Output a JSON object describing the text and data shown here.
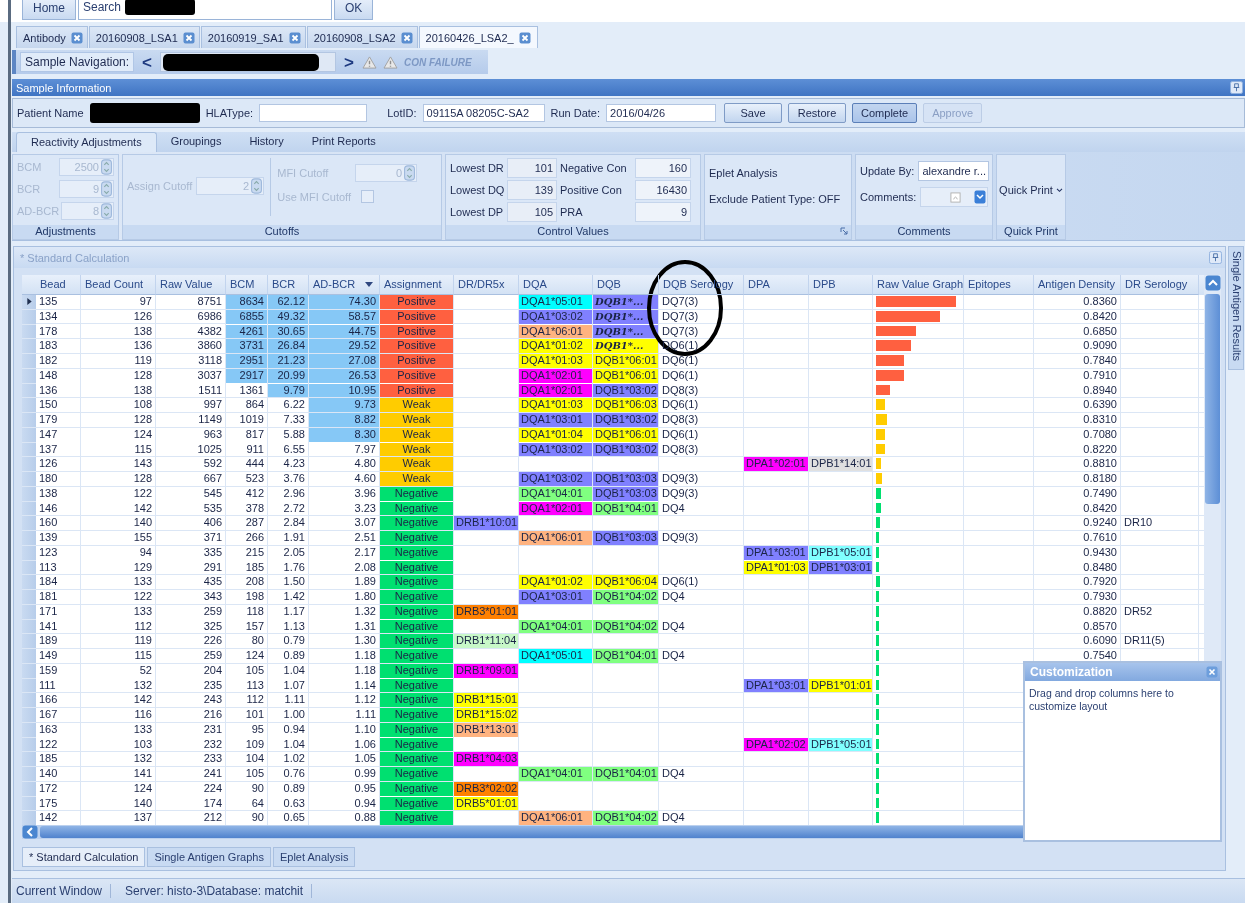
{
  "top_bar": {
    "home": "Home",
    "search_label": "Search",
    "ok": "OK"
  },
  "document_tabs": [
    {
      "label": "Antibody",
      "selected": false
    },
    {
      "label": "20160908_LSA1",
      "selected": false
    },
    {
      "label": "20160919_SA1",
      "selected": false
    },
    {
      "label": "20160908_LSA2",
      "selected": false
    },
    {
      "label": "20160426_LSA2_",
      "selected": true
    }
  ],
  "sample_navigation": {
    "label": "Sample Navigation:",
    "prev": "<",
    "next": ">",
    "status": "CON FAILURE"
  },
  "sample_information": {
    "title": "Sample Information",
    "patient_name_label": "Patient Name",
    "hla_type_label": "HLAType:",
    "lot_id_label": "LotID:",
    "lot_id": "09115A 08205C-SA2",
    "run_date_label": "Run Date:",
    "run_date": "2016/04/26",
    "buttons": [
      {
        "label": "Save",
        "disabled": false,
        "pressed": false
      },
      {
        "label": "Restore",
        "disabled": false,
        "pressed": false
      },
      {
        "label": "Complete",
        "disabled": false,
        "pressed": true
      },
      {
        "label": "Approve",
        "disabled": true,
        "pressed": false
      }
    ]
  },
  "ribbon_tabs": [
    {
      "label": "Reactivity Adjustments",
      "selected": true
    },
    {
      "label": "Groupings",
      "selected": false
    },
    {
      "label": "History",
      "selected": false
    },
    {
      "label": "Print Reports",
      "selected": false
    }
  ],
  "ribbon": {
    "adjustments": {
      "title": "Adjustments",
      "disabled": true,
      "fields": [
        {
          "label": "BCM",
          "value": "2500"
        },
        {
          "label": "BCR",
          "value": "9"
        },
        {
          "label": "AD-BCR",
          "value": "8"
        }
      ]
    },
    "cutoffs": {
      "title": "Cutoffs",
      "disabled": true,
      "assign_cutoff": {
        "label": "Assign Cutoff",
        "value": "2"
      },
      "mfi_cutoff": {
        "label": "MFI Cutoff",
        "value": "0"
      },
      "use_mfi_cutoff": {
        "label": "Use MFI Cutoff",
        "checked": false
      }
    },
    "control_values": {
      "title": "Control Values",
      "fields": [
        {
          "label": "Lowest DR",
          "value": "101"
        },
        {
          "label": "Negative Con",
          "value": "160"
        },
        {
          "label": "Lowest DQ",
          "value": "139"
        },
        {
          "label": "Positive Con",
          "value": "16430"
        },
        {
          "label": "Lowest DP",
          "value": "105"
        },
        {
          "label": "PRA",
          "value": "9"
        }
      ]
    },
    "eplet": {
      "items": [
        "Eplet Analysis",
        "Exclude Patient Type: OFF"
      ]
    },
    "comments": {
      "title": "Comments",
      "update_by_label": "Update By:",
      "update_by": "alexandre r...",
      "comments_label": "Comments:"
    },
    "quick_print": {
      "title": "Quick Print",
      "button": "Quick Print"
    }
  },
  "grid": {
    "title": "* Standard Calculation",
    "columns": [
      {
        "label": "Bead",
        "sorted": false
      },
      {
        "label": "Bead Count",
        "sorted": false
      },
      {
        "label": "Raw Value",
        "sorted": false
      },
      {
        "label": "BCM",
        "sorted": false
      },
      {
        "label": "BCR",
        "sorted": false
      },
      {
        "label": "AD-BCR",
        "sorted": true
      },
      {
        "label": "Assignment",
        "sorted": false
      },
      {
        "label": "DR/DR5x",
        "sorted": false
      },
      {
        "label": "DQA",
        "sorted": false
      },
      {
        "label": "DQB",
        "sorted": false
      },
      {
        "label": "DQB Serology",
        "sorted": false
      },
      {
        "label": "DPA",
        "sorted": false
      },
      {
        "label": "DPB",
        "sorted": false
      },
      {
        "label": "Raw Value Graph",
        "sorted": false
      },
      {
        "label": "Epitopes",
        "sorted": false
      },
      {
        "label": "Antigen Density",
        "sorted": false
      },
      {
        "label": "DR Serology",
        "sorted": false
      }
    ],
    "rows": [
      {
        "current": true,
        "bead": "135",
        "bead_count": "97",
        "raw_value": "8751",
        "bcm": "8634",
        "bcr": "62.12",
        "ad_bcr": "74.30",
        "bcm_flagged": true,
        "bcr_flagged": true,
        "ad_bcr_flagged": true,
        "assignment": {
          "text": "Positive",
          "color": "#ff6040"
        },
        "dqa": {
          "text": "DQA1*05:01",
          "color": "#00ffff"
        },
        "dqb": {
          "text": "DQB1*...",
          "color": "#8080ff",
          "bold": true
        },
        "dqb_serology": "DQ7(3)",
        "graph": {
          "color": "#ff6040"
        },
        "antigen_density": "0.8360"
      },
      {
        "current": false,
        "bead": "134",
        "bead_count": "126",
        "raw_value": "6986",
        "bcm": "6855",
        "bcr": "49.32",
        "ad_bcr": "58.57",
        "bcm_flagged": true,
        "bcr_flagged": true,
        "ad_bcr_flagged": true,
        "assignment": {
          "text": "Positive",
          "color": "#ff6040"
        },
        "dqa": {
          "text": "DQA1*03:02",
          "color": "#8080ff"
        },
        "dqb": {
          "text": "DQB1*...",
          "color": "#8080ff",
          "bold": true
        },
        "dqb_serology": "DQ7(3)",
        "graph": {
          "color": "#ff6040"
        },
        "antigen_density": "0.8420"
      },
      {
        "current": false,
        "bead": "178",
        "bead_count": "138",
        "raw_value": "4382",
        "bcm": "4261",
        "bcr": "30.65",
        "ad_bcr": "44.75",
        "bcm_flagged": true,
        "bcr_flagged": true,
        "ad_bcr_flagged": true,
        "assignment": {
          "text": "Positive",
          "color": "#ff6040"
        },
        "dqa": {
          "text": "DQA1*06:01",
          "color": "#ffb380"
        },
        "dqb": {
          "text": "DQB1*...",
          "color": "#8080ff",
          "bold": true
        },
        "dqb_serology": "DQ7(3)",
        "graph": {
          "color": "#ff6040"
        },
        "antigen_density": "0.6850"
      },
      {
        "current": false,
        "bead": "183",
        "bead_count": "136",
        "raw_value": "3860",
        "bcm": "3731",
        "bcr": "26.84",
        "ad_bcr": "29.52",
        "bcm_flagged": true,
        "bcr_flagged": true,
        "ad_bcr_flagged": true,
        "assignment": {
          "text": "Positive",
          "color": "#ff6040"
        },
        "dqa": {
          "text": "DQA1*01:02",
          "color": "#ffff00"
        },
        "dqb": {
          "text": "DQB1*...",
          "color": "#ffff00",
          "bold": true
        },
        "dqb_serology": "DQ6(1)",
        "graph": {
          "color": "#ff6040"
        },
        "antigen_density": "0.9090"
      },
      {
        "current": false,
        "bead": "182",
        "bead_count": "119",
        "raw_value": "3118",
        "bcm": "2951",
        "bcr": "21.23",
        "ad_bcr": "27.08",
        "bcm_flagged": true,
        "bcr_flagged": true,
        "ad_bcr_flagged": true,
        "assignment": {
          "text": "Positive",
          "color": "#ff6040"
        },
        "dqa": {
          "text": "DQA1*01:03",
          "color": "#ffff00"
        },
        "dqb": {
          "text": "DQB1*06:01",
          "color": "#ffff00"
        },
        "dqb_serology": "DQ6(1)",
        "graph": {
          "color": "#ff6040"
        },
        "antigen_density": "0.7840"
      },
      {
        "current": false,
        "bead": "148",
        "bead_count": "128",
        "raw_value": "3037",
        "bcm": "2917",
        "bcr": "20.99",
        "ad_bcr": "26.53",
        "bcm_flagged": true,
        "bcr_flagged": true,
        "ad_bcr_flagged": true,
        "assignment": {
          "text": "Positive",
          "color": "#ff6040"
        },
        "dqa": {
          "text": "DQA1*02:01",
          "color": "#ff00ff"
        },
        "dqb": {
          "text": "DQB1*06:01",
          "color": "#ffff00"
        },
        "dqb_serology": "DQ6(1)",
        "graph": {
          "color": "#ff6040"
        },
        "antigen_density": "0.7910"
      },
      {
        "current": false,
        "bead": "136",
        "bead_count": "138",
        "raw_value": "1511",
        "bcm": "1361",
        "bcr": "9.79",
        "ad_bcr": "10.95",
        "bcm_flagged": false,
        "bcr_flagged": true,
        "ad_bcr_flagged": true,
        "assignment": {
          "text": "Positive",
          "color": "#ff6040"
        },
        "dqa": {
          "text": "DQA1*02:01",
          "color": "#ff00ff"
        },
        "dqb": {
          "text": "DQB1*03:02",
          "color": "#8080ff"
        },
        "dqb_serology": "DQ8(3)",
        "graph": {
          "color": "#ff6040"
        },
        "antigen_density": "0.8940"
      },
      {
        "current": false,
        "bead": "150",
        "bead_count": "108",
        "raw_value": "997",
        "bcm": "864",
        "bcr": "6.22",
        "ad_bcr": "9.73",
        "bcm_flagged": false,
        "bcr_flagged": false,
        "ad_bcr_flagged": true,
        "assignment": {
          "text": "Weak",
          "color": "#ffcc00"
        },
        "dqa": {
          "text": "DQA1*01:03",
          "color": "#ffff00"
        },
        "dqb": {
          "text": "DQB1*06:03",
          "color": "#ffff00"
        },
        "dqb_serology": "DQ6(1)",
        "graph": {
          "color": "#ffcc00"
        },
        "antigen_density": "0.6390"
      },
      {
        "current": false,
        "bead": "179",
        "bead_count": "128",
        "raw_value": "1149",
        "bcm": "1019",
        "bcr": "7.33",
        "ad_bcr": "8.82",
        "bcm_flagged": false,
        "bcr_flagged": false,
        "ad_bcr_flagged": true,
        "assignment": {
          "text": "Weak",
          "color": "#ffcc00"
        },
        "dqa": {
          "text": "DQA1*03:01",
          "color": "#8080ff"
        },
        "dqb": {
          "text": "DQB1*03:02",
          "color": "#8080ff"
        },
        "dqb_serology": "DQ8(3)",
        "graph": {
          "color": "#ffcc00"
        },
        "antigen_density": "0.8310"
      },
      {
        "current": false,
        "bead": "147",
        "bead_count": "124",
        "raw_value": "963",
        "bcm": "817",
        "bcr": "5.88",
        "ad_bcr": "8.30",
        "bcm_flagged": false,
        "bcr_flagged": false,
        "ad_bcr_flagged": true,
        "assignment": {
          "text": "Weak",
          "color": "#ffcc00"
        },
        "dqa": {
          "text": "DQA1*01:04",
          "color": "#ffff00"
        },
        "dqb": {
          "text": "DQB1*06:01",
          "color": "#ffff00"
        },
        "dqb_serology": "DQ6(1)",
        "graph": {
          "color": "#ffcc00"
        },
        "antigen_density": "0.7080"
      },
      {
        "current": false,
        "bead": "137",
        "bead_count": "115",
        "raw_value": "1025",
        "bcm": "911",
        "bcr": "6.55",
        "ad_bcr": "7.97",
        "bcm_flagged": false,
        "bcr_flagged": false,
        "ad_bcr_flagged": false,
        "assignment": {
          "text": "Weak",
          "color": "#ffcc00"
        },
        "dqa": {
          "text": "DQA1*03:02",
          "color": "#8080ff"
        },
        "dqb": {
          "text": "DQB1*03:02",
          "color": "#8080ff"
        },
        "dqb_serology": "DQ8(3)",
        "graph": {
          "color": "#ffcc00"
        },
        "antigen_density": "0.8220"
      },
      {
        "current": false,
        "bead": "126",
        "bead_count": "143",
        "raw_value": "592",
        "bcm": "444",
        "bcr": "4.23",
        "ad_bcr": "4.80",
        "bcm_flagged": false,
        "bcr_flagged": false,
        "ad_bcr_flagged": false,
        "assignment": {
          "text": "Weak",
          "color": "#ffcc00"
        },
        "dpa": {
          "text": "DPA1*02:01",
          "color": "#ff00ff"
        },
        "dpb": {
          "text": "DPB1*14:01",
          "color": "#e0e0e0"
        },
        "graph": {
          "color": "#ffcc00"
        },
        "antigen_density": "0.8810"
      },
      {
        "current": false,
        "bead": "180",
        "bead_count": "128",
        "raw_value": "667",
        "bcm": "523",
        "bcr": "3.76",
        "ad_bcr": "4.60",
        "bcm_flagged": false,
        "bcr_flagged": false,
        "ad_bcr_flagged": false,
        "assignment": {
          "text": "Weak",
          "color": "#ffcc00"
        },
        "dqa": {
          "text": "DQA1*03:02",
          "color": "#8080ff"
        },
        "dqb": {
          "text": "DQB1*03:03",
          "color": "#8080ff"
        },
        "dqb_serology": "DQ9(3)",
        "graph": {
          "color": "#ffcc00"
        },
        "antigen_density": "0.8180"
      },
      {
        "current": false,
        "bead": "138",
        "bead_count": "122",
        "raw_value": "545",
        "bcm": "412",
        "bcr": "2.96",
        "ad_bcr": "3.96",
        "bcm_flagged": false,
        "bcr_flagged": false,
        "ad_bcr_flagged": false,
        "assignment": {
          "text": "Negative",
          "color": "#00e070"
        },
        "dqa": {
          "text": "DQA1*04:01",
          "color": "#80ff80"
        },
        "dqb": {
          "text": "DQB1*03:03",
          "color": "#8080ff"
        },
        "dqb_serology": "DQ9(3)",
        "graph": {
          "color": "#00e070"
        },
        "antigen_density": "0.7490"
      },
      {
        "current": false,
        "bead": "146",
        "bead_count": "142",
        "raw_value": "535",
        "bcm": "378",
        "bcr": "2.72",
        "ad_bcr": "3.23",
        "bcm_flagged": false,
        "bcr_flagged": false,
        "ad_bcr_flagged": false,
        "assignment": {
          "text": "Negative",
          "color": "#00e070"
        },
        "dqa": {
          "text": "DQA1*02:01",
          "color": "#ff00ff"
        },
        "dqb": {
          "text": "DQB1*04:01",
          "color": "#80ff80"
        },
        "dqb_serology": "DQ4",
        "graph": {
          "color": "#00e070"
        },
        "antigen_density": "0.8420"
      },
      {
        "current": false,
        "bead": "160",
        "bead_count": "140",
        "raw_value": "406",
        "bcm": "287",
        "bcr": "2.84",
        "ad_bcr": "3.07",
        "bcm_flagged": false,
        "bcr_flagged": false,
        "ad_bcr_flagged": false,
        "assignment": {
          "text": "Negative",
          "color": "#00e070"
        },
        "dr_dr5x": {
          "text": "DRB1*10:01",
          "color": "#8080ff"
        },
        "graph": {
          "color": "#00e070"
        },
        "antigen_density": "0.9240",
        "dr_serology": "DR10"
      },
      {
        "current": false,
        "bead": "139",
        "bead_count": "155",
        "raw_value": "371",
        "bcm": "266",
        "bcr": "1.91",
        "ad_bcr": "2.51",
        "bcm_flagged": false,
        "bcr_flagged": false,
        "ad_bcr_flagged": false,
        "assignment": {
          "text": "Negative",
          "color": "#00e070"
        },
        "dqa": {
          "text": "DQA1*06:01",
          "color": "#ffb380"
        },
        "dqb": {
          "text": "DQB1*03:03",
          "color": "#8080ff"
        },
        "dqb_serology": "DQ9(3)",
        "graph": {
          "color": "#00e070"
        },
        "antigen_density": "0.7610"
      },
      {
        "current": false,
        "bead": "123",
        "bead_count": "94",
        "raw_value": "335",
        "bcm": "215",
        "bcr": "2.05",
        "ad_bcr": "2.17",
        "bcm_flagged": false,
        "bcr_flagged": false,
        "ad_bcr_flagged": false,
        "assignment": {
          "text": "Negative",
          "color": "#00e070"
        },
        "dpa": {
          "text": "DPA1*03:01",
          "color": "#8080ff"
        },
        "dpb": {
          "text": "DPB1*05:01",
          "color": "#80ffff"
        },
        "graph": {
          "color": "#00e070"
        },
        "antigen_density": "0.9430"
      },
      {
        "current": false,
        "bead": "113",
        "bead_count": "129",
        "raw_value": "291",
        "bcm": "185",
        "bcr": "1.76",
        "ad_bcr": "2.08",
        "bcm_flagged": false,
        "bcr_flagged": false,
        "ad_bcr_flagged": false,
        "assignment": {
          "text": "Negative",
          "color": "#00e070"
        },
        "dpa": {
          "text": "DPA1*01:03",
          "color": "#ffff00"
        },
        "dpb": {
          "text": "DPB1*03:01",
          "color": "#8080ff"
        },
        "graph": {
          "color": "#00e070"
        },
        "antigen_density": "0.8480"
      },
      {
        "current": false,
        "bead": "184",
        "bead_count": "133",
        "raw_value": "435",
        "bcm": "208",
        "bcr": "1.50",
        "ad_bcr": "1.89",
        "bcm_flagged": false,
        "bcr_flagged": false,
        "ad_bcr_flagged": false,
        "assignment": {
          "text": "Negative",
          "color": "#00e070"
        },
        "dqa": {
          "text": "DQA1*01:02",
          "color": "#ffff00"
        },
        "dqb": {
          "text": "DQB1*06:04",
          "color": "#ffff00"
        },
        "dqb_serology": "DQ6(1)",
        "graph": {
          "color": "#00e070"
        },
        "antigen_density": "0.7920"
      },
      {
        "current": false,
        "bead": "181",
        "bead_count": "122",
        "raw_value": "343",
        "bcm": "198",
        "bcr": "1.42",
        "ad_bcr": "1.80",
        "bcm_flagged": false,
        "bcr_flagged": false,
        "ad_bcr_flagged": false,
        "assignment": {
          "text": "Negative",
          "color": "#00e070"
        },
        "dqa": {
          "text": "DQA1*03:01",
          "color": "#8080ff"
        },
        "dqb": {
          "text": "DQB1*04:02",
          "color": "#80ff80"
        },
        "dqb_serology": "DQ4",
        "graph": {
          "color": "#00e070"
        },
        "antigen_density": "0.7930"
      },
      {
        "current": false,
        "bead": "171",
        "bead_count": "133",
        "raw_value": "259",
        "bcm": "118",
        "bcr": "1.17",
        "ad_bcr": "1.32",
        "bcm_flagged": false,
        "bcr_flagged": false,
        "ad_bcr_flagged": false,
        "assignment": {
          "text": "Negative",
          "color": "#00e070"
        },
        "dr_dr5x": {
          "text": "DRB3*01:01",
          "color": "#ff8000"
        },
        "graph": {
          "color": "#00e070"
        },
        "antigen_density": "0.8820",
        "dr_serology": "DR52"
      },
      {
        "current": false,
        "bead": "141",
        "bead_count": "112",
        "raw_value": "325",
        "bcm": "157",
        "bcr": "1.13",
        "ad_bcr": "1.31",
        "bcm_flagged": false,
        "bcr_flagged": false,
        "ad_bcr_flagged": false,
        "assignment": {
          "text": "Negative",
          "color": "#00e070"
        },
        "dqa": {
          "text": "DQA1*04:01",
          "color": "#80ff80"
        },
        "dqb": {
          "text": "DQB1*04:02",
          "color": "#80ff80"
        },
        "dqb_serology": "DQ4",
        "graph": {
          "color": "#00e070"
        },
        "antigen_density": "0.8570"
      },
      {
        "current": false,
        "bead": "189",
        "bead_count": "119",
        "raw_value": "226",
        "bcm": "80",
        "bcr": "0.79",
        "ad_bcr": "1.30",
        "bcm_flagged": false,
        "bcr_flagged": false,
        "ad_bcr_flagged": false,
        "assignment": {
          "text": "Negative",
          "color": "#00e070"
        },
        "dr_dr5x": {
          "text": "DRB1*11:04",
          "color": "#c8f8c8"
        },
        "graph": {
          "color": "#00e070"
        },
        "antigen_density": "0.6090",
        "dr_serology": "DR11(5)"
      },
      {
        "current": false,
        "bead": "149",
        "bead_count": "115",
        "raw_value": "259",
        "bcm": "124",
        "bcr": "0.89",
        "ad_bcr": "1.18",
        "bcm_flagged": false,
        "bcr_flagged": false,
        "ad_bcr_flagged": false,
        "assignment": {
          "text": "Negative",
          "color": "#00e070"
        },
        "dqa": {
          "text": "DQA1*05:01",
          "color": "#00ffff"
        },
        "dqb": {
          "text": "DQB1*04:01",
          "color": "#80ff80"
        },
        "dqb_serology": "DQ4",
        "graph": {
          "color": "#00e070"
        },
        "antigen_density": "0.7540"
      },
      {
        "current": false,
        "bead": "159",
        "bead_count": "52",
        "raw_value": "204",
        "bcm": "105",
        "bcr": "1.04",
        "ad_bcr": "1.18",
        "bcm_flagged": false,
        "bcr_flagged": false,
        "ad_bcr_flagged": false,
        "assignment": {
          "text": "Negative",
          "color": "#00e070"
        },
        "dr_dr5x": {
          "text": "DRB1*09:01",
          "color": "#ff00ff"
        },
        "graph": {
          "color": "#00e070"
        }
      },
      {
        "current": false,
        "bead": "111",
        "bead_count": "132",
        "raw_value": "235",
        "bcm": "113",
        "bcr": "1.07",
        "ad_bcr": "1.14",
        "bcm_flagged": false,
        "bcr_flagged": false,
        "ad_bcr_flagged": false,
        "assignment": {
          "text": "Negative",
          "color": "#00e070"
        },
        "dpa": {
          "text": "DPA1*03:01",
          "color": "#8080ff"
        },
        "dpb": {
          "text": "DPB1*01:01",
          "color": "#ffff00"
        },
        "graph": {
          "color": "#00e070"
        }
      },
      {
        "current": false,
        "bead": "166",
        "bead_count": "142",
        "raw_value": "243",
        "bcm": "112",
        "bcr": "1.11",
        "ad_bcr": "1.12",
        "bcm_flagged": false,
        "bcr_flagged": false,
        "ad_bcr_flagged": false,
        "assignment": {
          "text": "Negative",
          "color": "#00e070"
        },
        "dr_dr5x": {
          "text": "DRB1*15:01",
          "color": "#ffff00"
        },
        "graph": {
          "color": "#00e070"
        }
      },
      {
        "current": false,
        "bead": "167",
        "bead_count": "116",
        "raw_value": "216",
        "bcm": "101",
        "bcr": "1.00",
        "ad_bcr": "1.11",
        "bcm_flagged": false,
        "bcr_flagged": false,
        "ad_bcr_flagged": false,
        "assignment": {
          "text": "Negative",
          "color": "#00e070"
        },
        "dr_dr5x": {
          "text": "DRB1*15:02",
          "color": "#ffff00"
        },
        "graph": {
          "color": "#00e070"
        }
      },
      {
        "current": false,
        "bead": "163",
        "bead_count": "133",
        "raw_value": "231",
        "bcm": "95",
        "bcr": "0.94",
        "ad_bcr": "1.10",
        "bcm_flagged": false,
        "bcr_flagged": false,
        "ad_bcr_flagged": false,
        "assignment": {
          "text": "Negative",
          "color": "#00e070"
        },
        "dr_dr5x": {
          "text": "DRB1*13:01",
          "color": "#ffb380"
        },
        "graph": {
          "color": "#00e070"
        }
      },
      {
        "current": false,
        "bead": "122",
        "bead_count": "103",
        "raw_value": "232",
        "bcm": "109",
        "bcr": "1.04",
        "ad_bcr": "1.06",
        "bcm_flagged": false,
        "bcr_flagged": false,
        "ad_bcr_flagged": false,
        "assignment": {
          "text": "Negative",
          "color": "#00e070"
        },
        "dpa": {
          "text": "DPA1*02:02",
          "color": "#ff00ff"
        },
        "dpb": {
          "text": "DPB1*05:01",
          "color": "#80ffff"
        },
        "graph": {
          "color": "#00e070"
        }
      },
      {
        "current": false,
        "bead": "185",
        "bead_count": "132",
        "raw_value": "233",
        "bcm": "104",
        "bcr": "1.02",
        "ad_bcr": "1.05",
        "bcm_flagged": false,
        "bcr_flagged": false,
        "ad_bcr_flagged": false,
        "assignment": {
          "text": "Negative",
          "color": "#00e070"
        },
        "dr_dr5x": {
          "text": "DRB1*04:03",
          "color": "#ff00ff"
        },
        "graph": {
          "color": "#00e070"
        }
      },
      {
        "current": false,
        "bead": "140",
        "bead_count": "141",
        "raw_value": "241",
        "bcm": "105",
        "bcr": "0.76",
        "ad_bcr": "0.99",
        "bcm_flagged": false,
        "bcr_flagged": false,
        "ad_bcr_flagged": false,
        "assignment": {
          "text": "Negative",
          "color": "#00e070"
        },
        "dqa": {
          "text": "DQA1*04:01",
          "color": "#80ff80"
        },
        "dqb": {
          "text": "DQB1*04:01",
          "color": "#80ff80"
        },
        "dqb_serology": "DQ4",
        "graph": {
          "color": "#00e070"
        }
      },
      {
        "current": false,
        "bead": "172",
        "bead_count": "124",
        "raw_value": "224",
        "bcm": "90",
        "bcr": "0.89",
        "ad_bcr": "0.95",
        "bcm_flagged": false,
        "bcr_flagged": false,
        "ad_bcr_flagged": false,
        "assignment": {
          "text": "Negative",
          "color": "#00e070"
        },
        "dr_dr5x": {
          "text": "DRB3*02:02",
          "color": "#ff8000"
        },
        "graph": {
          "color": "#00e070"
        }
      },
      {
        "current": false,
        "bead": "175",
        "bead_count": "140",
        "raw_value": "174",
        "bcm": "64",
        "bcr": "0.63",
        "ad_bcr": "0.94",
        "bcm_flagged": false,
        "bcr_flagged": false,
        "ad_bcr_flagged": false,
        "assignment": {
          "text": "Negative",
          "color": "#00e070"
        },
        "dr_dr5x": {
          "text": "DRB5*01:01",
          "color": "#ffff00"
        },
        "graph": {
          "color": "#00e070"
        }
      },
      {
        "current": false,
        "bead": "142",
        "bead_count": "137",
        "raw_value": "212",
        "bcm": "90",
        "bcr": "0.65",
        "ad_bcr": "0.88",
        "bcm_flagged": false,
        "bcr_flagged": false,
        "ad_bcr_flagged": false,
        "assignment": {
          "text": "Negative",
          "color": "#00e070"
        },
        "dqa": {
          "text": "DQA1*06:01",
          "color": "#ffb380"
        },
        "dqb": {
          "text": "DQB1*04:02",
          "color": "#80ff80"
        },
        "dqb_serology": "DQ4",
        "graph": {
          "color": "#00e070"
        }
      }
    ]
  },
  "customization": {
    "title": "Customization",
    "text": "Drag and drop columns here to customize layout"
  },
  "bottom_tabs": [
    {
      "label": "* Standard Calculation",
      "selected": true
    },
    {
      "label": "Single Antigen Graphs",
      "selected": false
    },
    {
      "label": "Eplet Analysis",
      "selected": false
    }
  ],
  "side_tab": "Single Antigen Results",
  "status_bar": [
    "Current Window",
    "Server: histo-3\\Database: matchit"
  ]
}
